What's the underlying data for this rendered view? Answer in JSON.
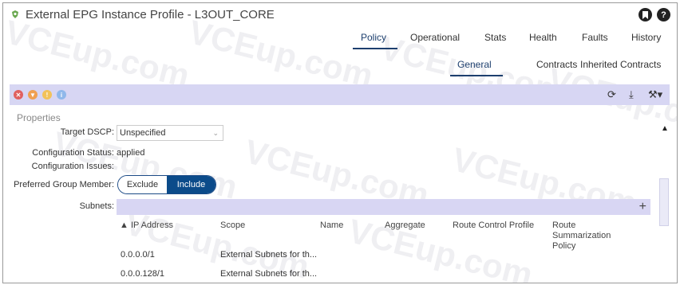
{
  "header": {
    "title": "External EPG Instance Profile - L3OUT_CORE",
    "bookmark_icon": "bookmark-icon",
    "help_icon_label": "?"
  },
  "main_tabs": [
    "Policy",
    "Operational",
    "Stats",
    "Health",
    "Faults",
    "History"
  ],
  "sub_tabs": [
    "General",
    "Contracts",
    "Inherited Contracts"
  ],
  "properties": {
    "section_label": "Properties",
    "target_dscp_label": "Target DSCP:",
    "target_dscp_value": "Unspecified",
    "config_status_label": "Configuration Status:",
    "config_status_value": "applied",
    "config_issues_label": "Configuration Issues:",
    "preferred_group_label": "Preferred Group Member:",
    "preferred_group_options": [
      "Exclude",
      "Include"
    ],
    "subnets_label": "Subnets:"
  },
  "subnets_table": {
    "columns": [
      "▲ IP Address",
      "Scope",
      "Name",
      "Aggregate",
      "Route Control Profile",
      "Route Summarization Policy"
    ],
    "rows": [
      [
        "0.0.0.0/1",
        "External Subnets for th..."
      ],
      [
        "0.0.0.128/1",
        "External Subnets for th..."
      ]
    ]
  },
  "colors": {
    "toolbar_bg": "#d7d6f3",
    "active_blue": "#0b4b8a"
  },
  "watermark": "VCEup.com"
}
